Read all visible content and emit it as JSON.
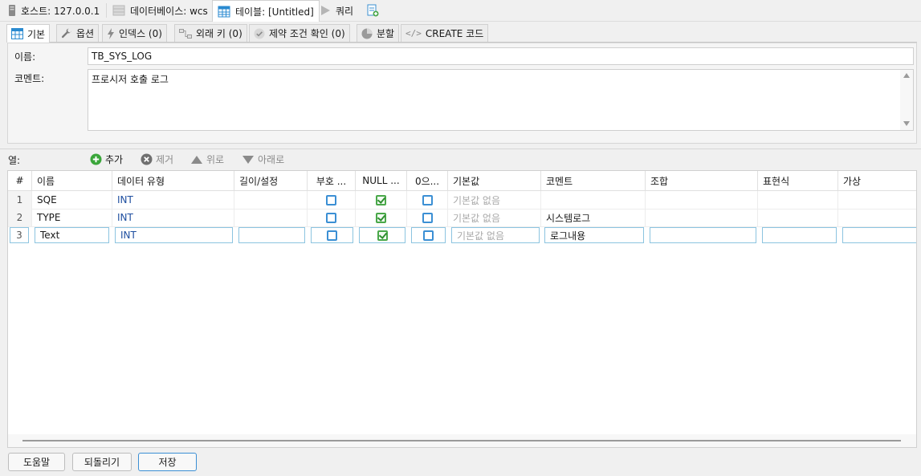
{
  "top_tabs": {
    "host": "호스트: 127.0.0.1",
    "database": "데이터베이스: wcs",
    "table": "테이블: [Untitled]",
    "query": "쿼리"
  },
  "sub_tabs": {
    "basic": "기본",
    "options": "옵션",
    "indexes": "인덱스 (0)",
    "foreign_keys": "외래 키 (0)",
    "check_constraints": "제약 조건 확인 (0)",
    "partitions": "분할",
    "create_code": "CREATE 코드"
  },
  "form": {
    "name_label": "이름:",
    "name_value": "TB_SYS_LOG",
    "comment_label": "코멘트:",
    "comment_value": "프로시저 호출 로그"
  },
  "columns_toolbar": {
    "label": "열:",
    "add": "추가",
    "remove": "제거",
    "up": "위로",
    "down": "아래로"
  },
  "grid": {
    "headers": {
      "num": "#",
      "name": "이름",
      "type": "데이터 유형",
      "length": "길이/설정",
      "unsigned": "부호 ...",
      "allow_null": "NULL ...",
      "zerofill": "0으...",
      "default": "기본값",
      "comment": "코멘트",
      "collation": "조합",
      "expression": "표현식",
      "virtual": "가상"
    },
    "rows": [
      {
        "num": "1",
        "name": "SQE",
        "type": "INT",
        "default": "기본값 없음",
        "comment": "",
        "unsigned": false,
        "allow_null": true,
        "zerofill": false
      },
      {
        "num": "2",
        "name": "TYPE",
        "type": "INT",
        "default": "기본값 없음",
        "comment": "시스템로그",
        "unsigned": false,
        "allow_null": true,
        "zerofill": false
      },
      {
        "num": "3",
        "name": "Text",
        "type": "INT",
        "default": "기본값 없음",
        "comment": "로그내용",
        "unsigned": false,
        "allow_null": true,
        "zerofill": false
      }
    ]
  },
  "footer": {
    "help": "도움말",
    "revert": "되돌리기",
    "save": "저장"
  },
  "colors": {
    "accent": "#3b8fd4",
    "check_green": "#4aa84a",
    "type_text": "#1f4fa0",
    "placeholder": "#a9a9a9"
  }
}
